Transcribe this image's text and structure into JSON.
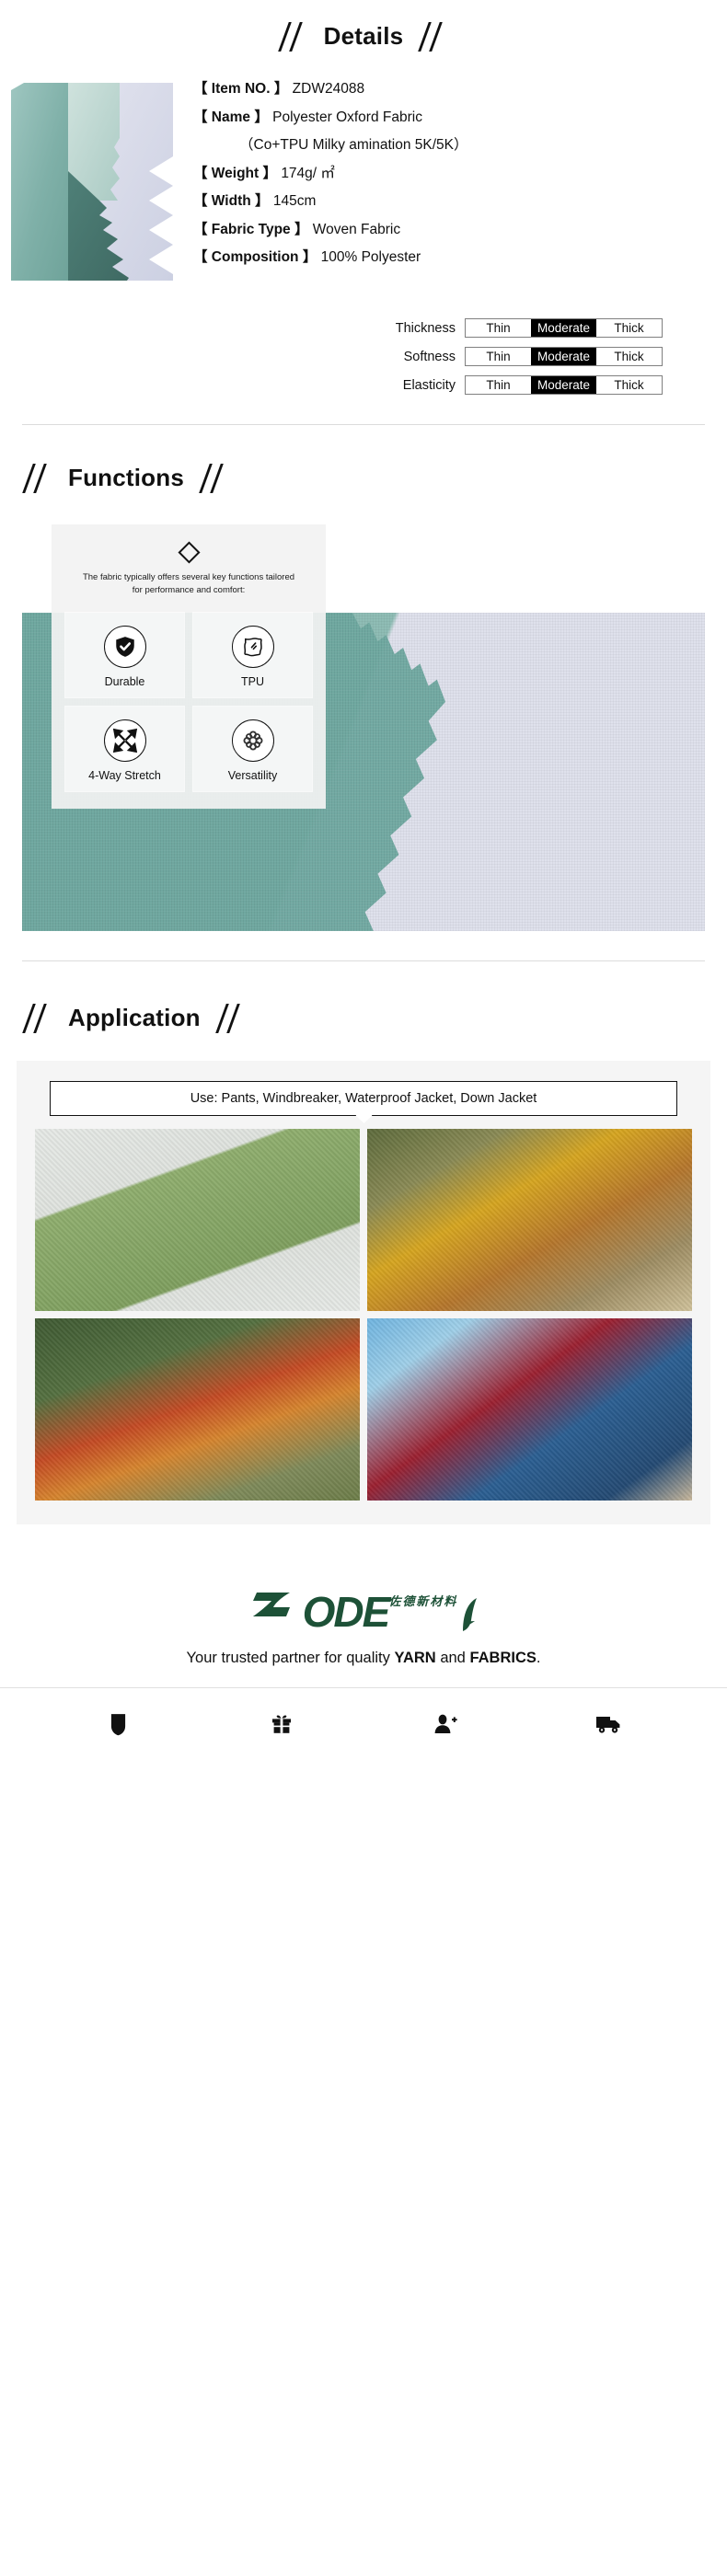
{
  "details": {
    "heading": "Details",
    "swatch_alt": "fabric-swatch",
    "specs": [
      {
        "label": "【 Item NO. 】",
        "value": "ZDW24088"
      },
      {
        "label": "【 Name 】",
        "value": "Polyester Oxford Fabric",
        "sub": "（Co+TPU Milky amination 5K/5K）"
      },
      {
        "label": "【 Weight 】",
        "value": "174g/ ㎡"
      },
      {
        "label": "【 Width 】",
        "value": "145cm"
      },
      {
        "label": "【 Fabric Type 】",
        "value": "Woven Fabric"
      },
      {
        "label": "【 Composition 】",
        "value": "100% Polyester"
      }
    ],
    "ratings": [
      {
        "name": "Thickness",
        "options": [
          "Thin",
          "Moderate",
          "Thick"
        ],
        "selected": "Moderate"
      },
      {
        "name": "Softness",
        "options": [
          "Thin",
          "Moderate",
          "Thick"
        ],
        "selected": "Moderate"
      },
      {
        "name": "Elasticity",
        "options": [
          "Thin",
          "Moderate",
          "Thick"
        ],
        "selected": "Moderate"
      }
    ]
  },
  "functions": {
    "heading": "Functions",
    "intro": "The fabric typically offers several key functions tailored for performance and comfort:",
    "cards": [
      {
        "icon": "shield-check-icon",
        "label": "Durable"
      },
      {
        "icon": "tpu-film-icon",
        "label": "TPU"
      },
      {
        "icon": "four-way-arrows-icon",
        "label": "4-Way Stretch"
      },
      {
        "icon": "celtic-knot-icon",
        "label": "Versatility"
      }
    ]
  },
  "application": {
    "heading": "Application",
    "use_text": "Use: Pants, Windbreaker, Waterproof Jacket, Down Jacket",
    "photos": [
      {
        "name": "green-hooded-jacket-product-photo"
      },
      {
        "name": "couple-hiking-yellow-jacket-photo"
      },
      {
        "name": "family-outdoors-camping-photo"
      },
      {
        "name": "couple-with-tablet-outdoors-photo"
      }
    ]
  },
  "footer": {
    "logo_text": "ODE",
    "logo_cn": "佐德新材料",
    "tagline_pre": "Your trusted partner for quality ",
    "tagline_yarn": "YARN",
    "tagline_mid": " and ",
    "tagline_fabrics": "FABRICS",
    "tagline_end": ".",
    "brand_color": "#1d5137",
    "toolbar": [
      {
        "icon": "shield-icon",
        "name": "quality-guarantee-button"
      },
      {
        "icon": "gift-icon",
        "name": "gift-sample-button"
      },
      {
        "icon": "add-user-icon",
        "name": "add-contact-button"
      },
      {
        "icon": "truck-icon",
        "name": "shipping-button"
      }
    ]
  }
}
